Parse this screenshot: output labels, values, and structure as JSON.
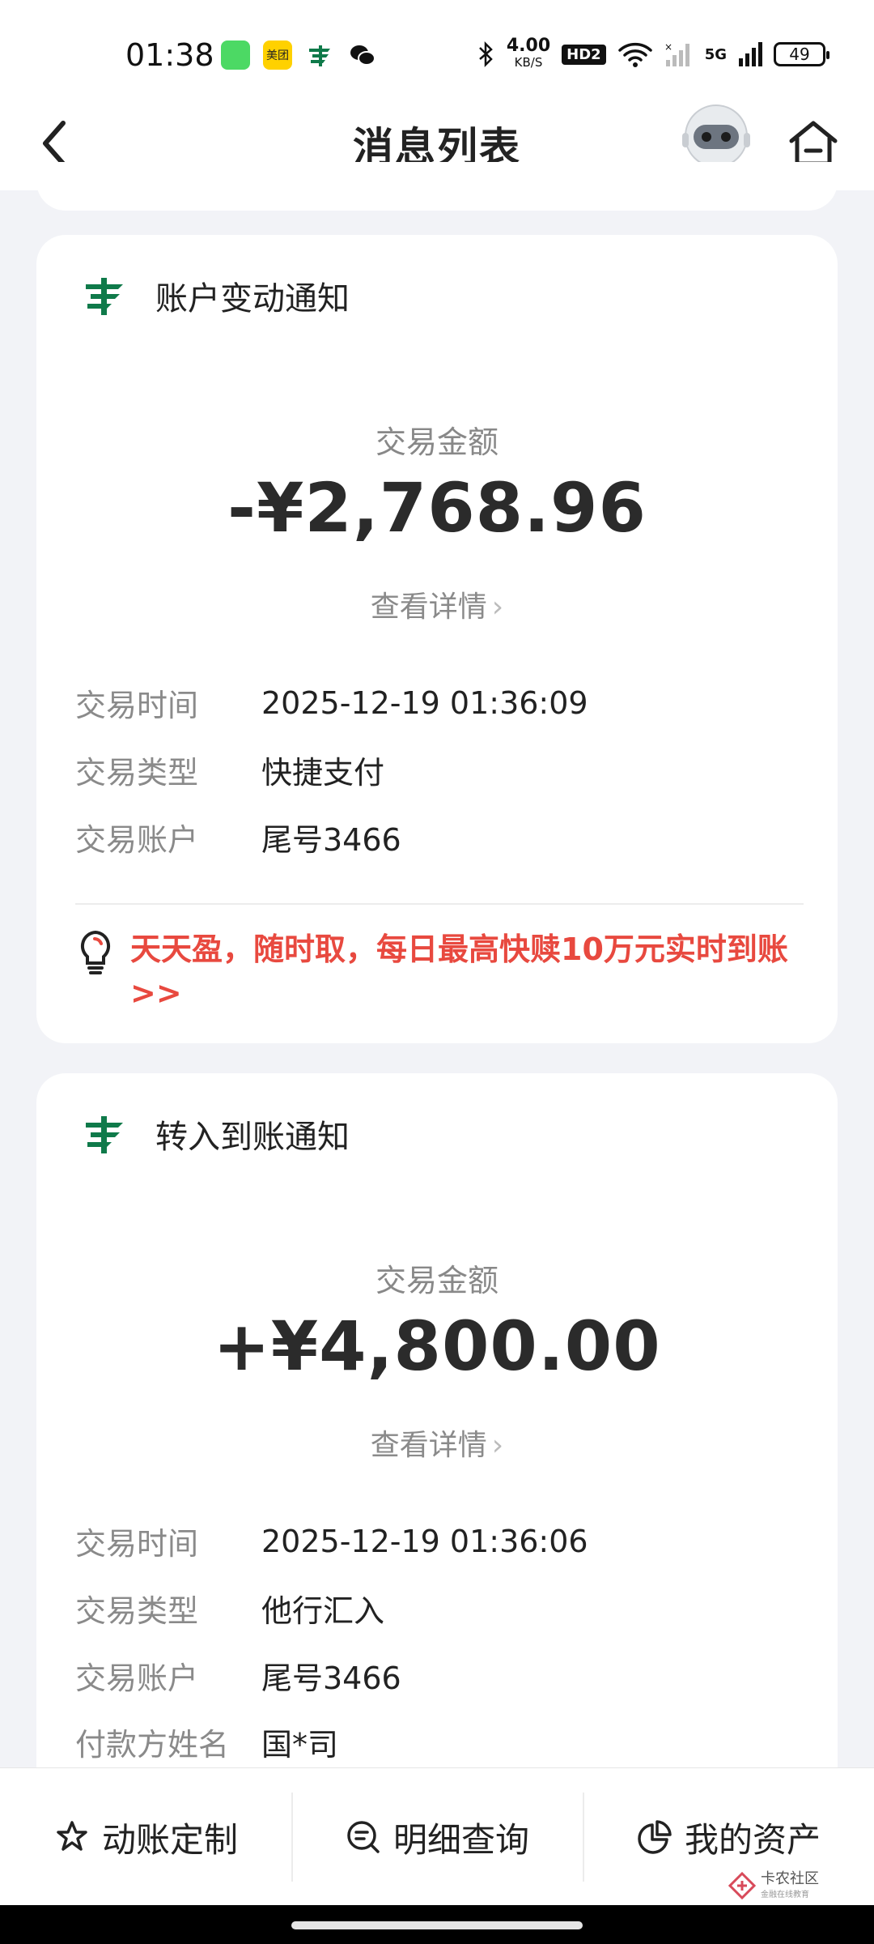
{
  "status_bar": {
    "time": "01:38",
    "apps": [
      "messages-icon",
      "meituan-icon",
      "postal-icon",
      "wechat-icon"
    ],
    "meituan_label": "美团",
    "net_speed_value": "4.00",
    "net_speed_unit": "KB/S",
    "hd_badge": "HD2",
    "network": "5G",
    "battery": "49"
  },
  "header": {
    "title": "消息列表",
    "back_icon": "chevron-left-icon",
    "assistant_icon": "robot-icon",
    "home_icon": "home-icon"
  },
  "messages": [
    {
      "title": "账户变动通知",
      "amount_label": "交易金额",
      "amount": "-¥2,768.96",
      "detail_link": "查看详情",
      "rows": [
        {
          "key": "交易时间",
          "value": "2025-12-19 01:36:09"
        },
        {
          "key": "交易类型",
          "value": "快捷支付"
        },
        {
          "key": "交易账户",
          "value": "尾号3466"
        }
      ],
      "promo": "天天盈，随时取，每日最高快赎10万元实时到账>>"
    },
    {
      "title": "转入到账通知",
      "amount_label": "交易金额",
      "amount": "+¥4,800.00",
      "detail_link": "查看详情",
      "rows": [
        {
          "key": "交易时间",
          "value": "2025-12-19 01:36:06"
        },
        {
          "key": "交易类型",
          "value": "他行汇入"
        },
        {
          "key": "交易账户",
          "value": "尾号3466"
        },
        {
          "key": "付款方姓名",
          "value": "国*司"
        }
      ]
    }
  ],
  "tabbar": {
    "items": [
      {
        "label": "动账定制",
        "icon": "star-outline-icon"
      },
      {
        "label": "明细查询",
        "icon": "search-list-icon"
      },
      {
        "label": "我的资产",
        "icon": "pie-chart-icon"
      }
    ]
  },
  "watermark": {
    "title": "卡农社区",
    "subtitle": "金融在线教育"
  },
  "colors": {
    "brand_green": "#0f7a4a",
    "promo_red": "#e8493f",
    "background": "#f2f3f7"
  }
}
